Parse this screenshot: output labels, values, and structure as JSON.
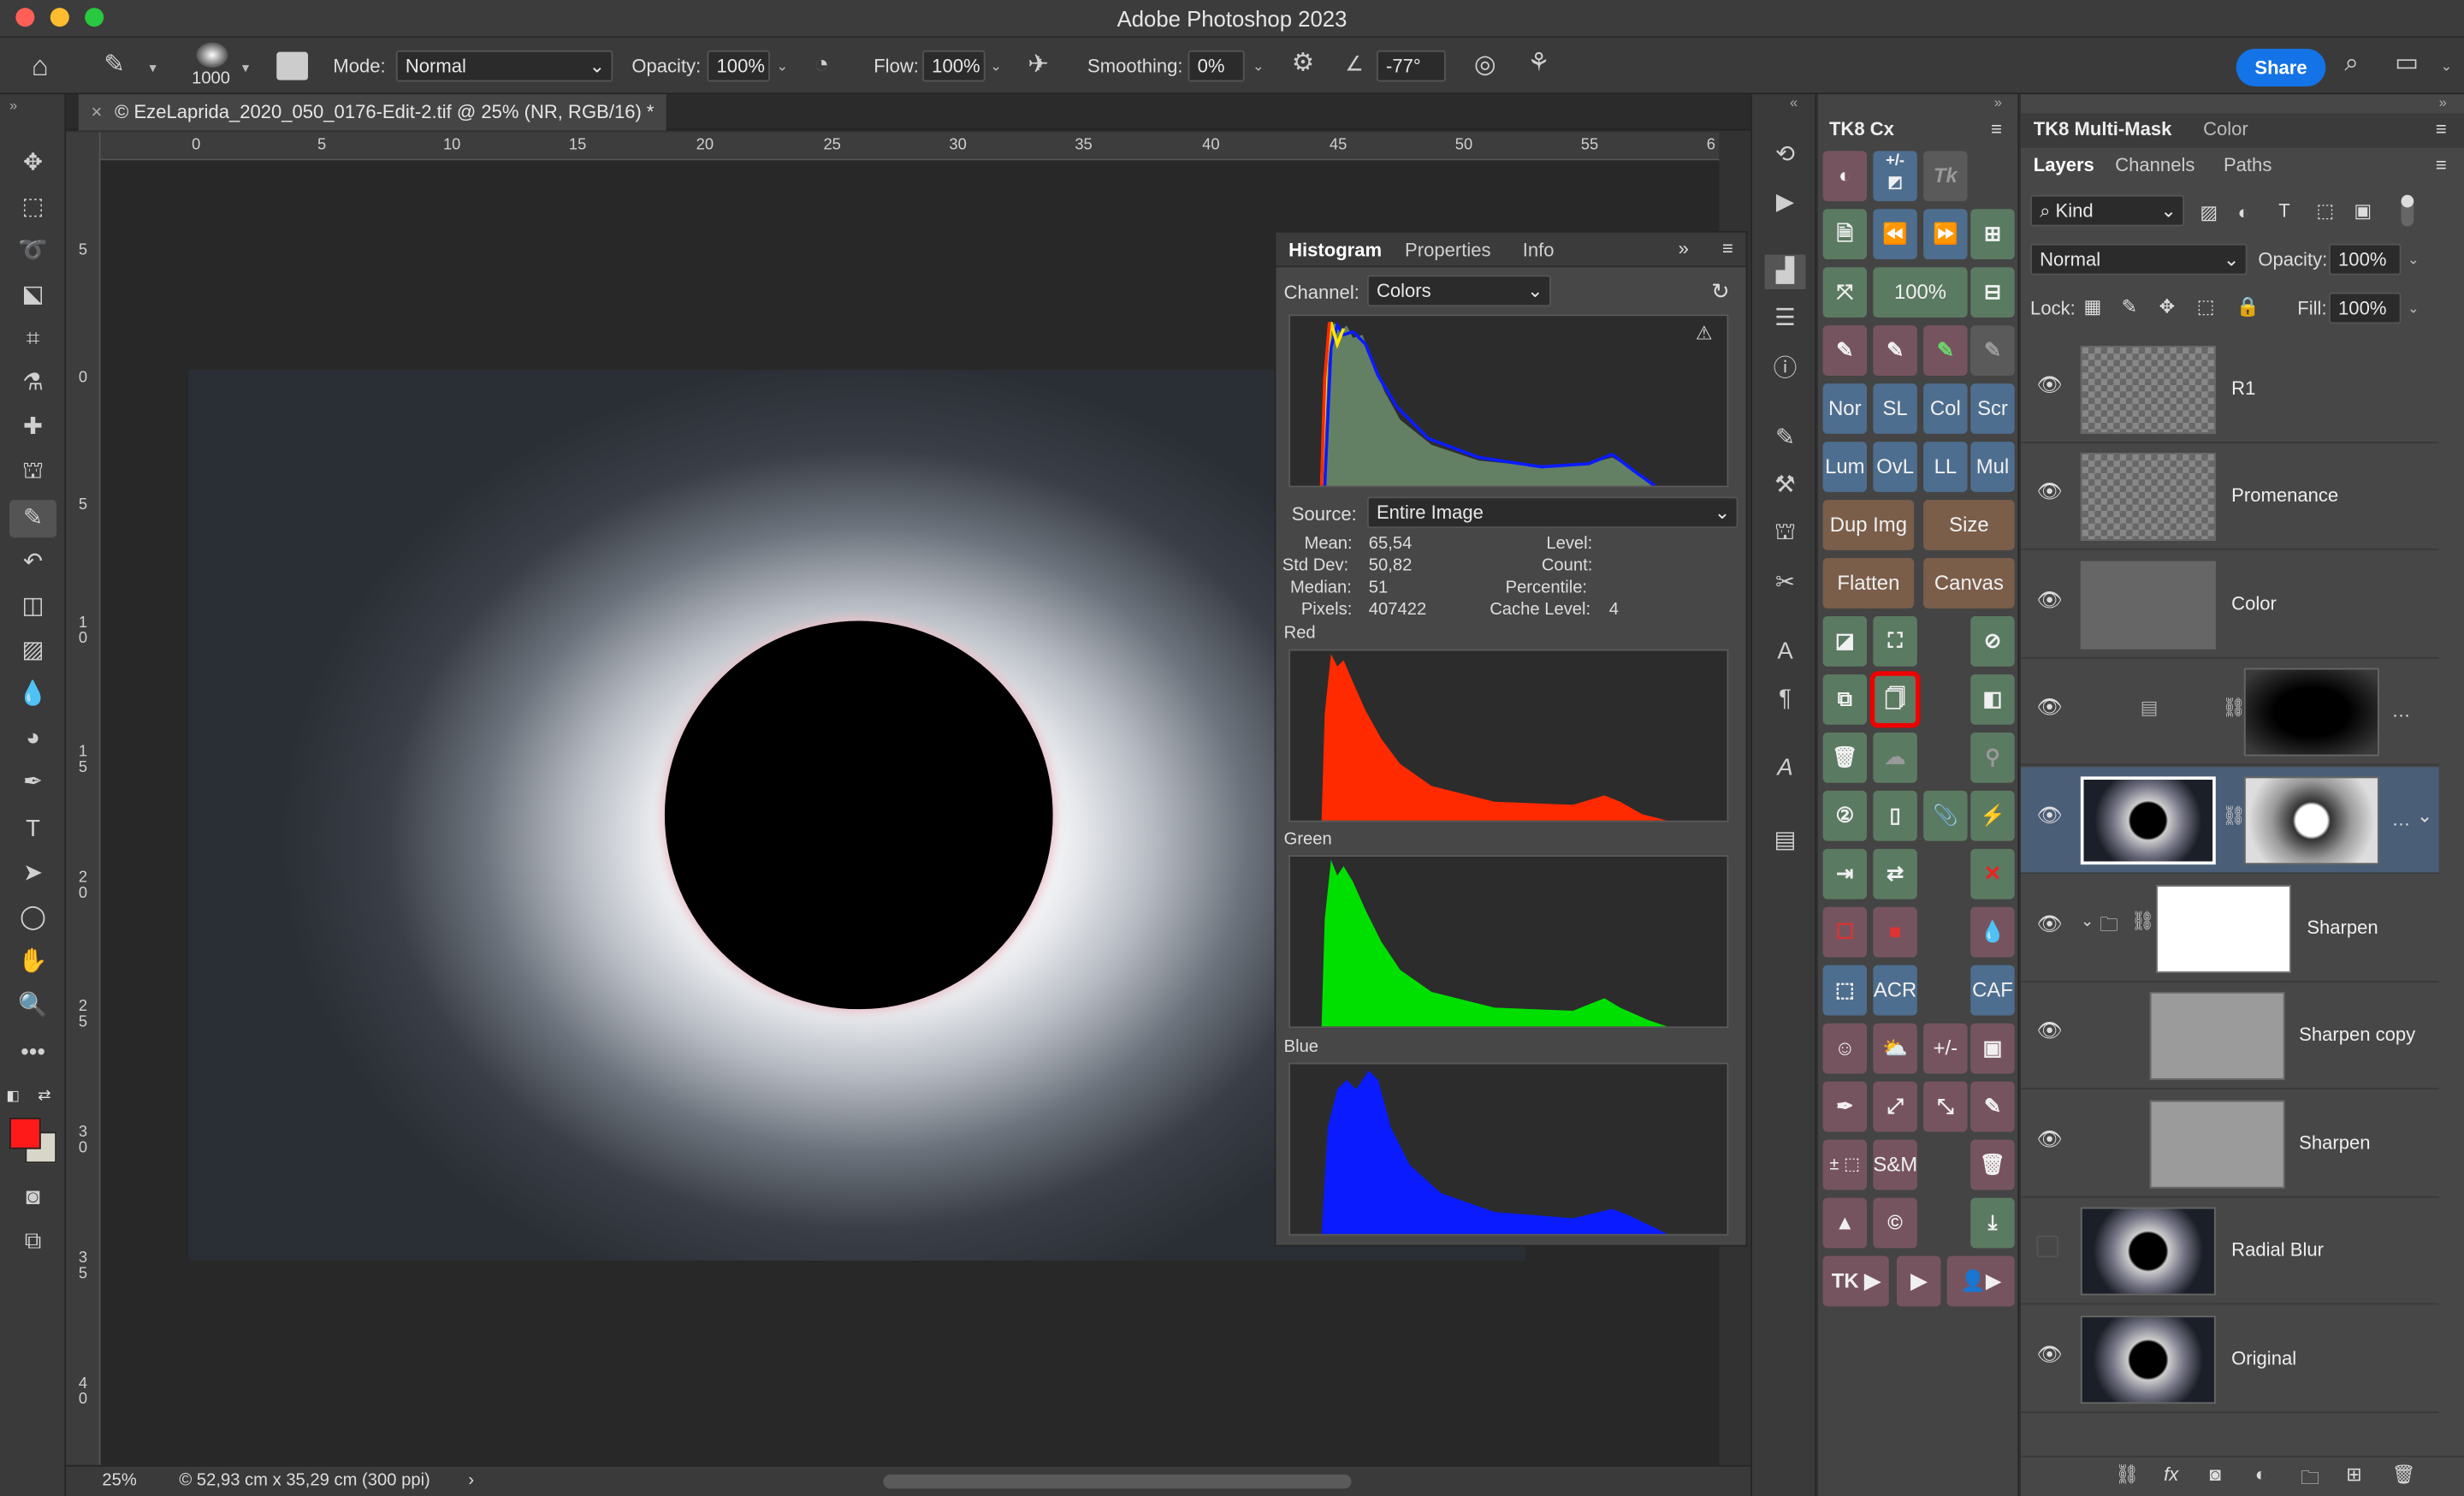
{
  "app": {
    "title": "Adobe Photoshop 2023"
  },
  "options": {
    "brush_size": "1000",
    "mode_label": "Mode:",
    "mode_value": "Normal",
    "opacity_label": "Opacity:",
    "opacity_value": "100%",
    "flow_label": "Flow:",
    "flow_value": "100%",
    "smoothing_label": "Smoothing:",
    "smoothing_value": "0%",
    "angle_value": "-77°",
    "share_label": "Share"
  },
  "document": {
    "tab_title": "© EzeLaprida_2020_050_0176-Edit-2.tif @ 25% (NR, RGB/16) *",
    "zoom": "25%",
    "doc_info": "© 52,93 cm x 35,29 cm (300 ppi)",
    "h_ruler": [
      "0",
      "5",
      "10",
      "15",
      "20",
      "25",
      "30",
      "35",
      "40",
      "45",
      "50",
      "55",
      "6"
    ],
    "v_ruler": [
      "5",
      "0",
      "5",
      "1 0",
      "1 5",
      "2 0",
      "2 5",
      "3 0",
      "3 5",
      "4 0"
    ]
  },
  "histogram": {
    "tabs": [
      "Histogram",
      "Properties",
      "Info"
    ],
    "channel_label": "Channel:",
    "channel_value": "Colors",
    "source_label": "Source:",
    "source_value": "Entire Image",
    "stats": {
      "mean_label": "Mean:",
      "mean": "65,54",
      "std_label": "Std Dev:",
      "std": "50,82",
      "median_label": "Median:",
      "median": "51",
      "pixels_label": "Pixels:",
      "pixels": "407422",
      "level_label": "Level:",
      "count_label": "Count:",
      "percentile_label": "Percentile:",
      "cache_label": "Cache Level:",
      "cache": "4"
    },
    "channels": [
      "Red",
      "Green",
      "Blue"
    ],
    "colors": {
      "red": "#ff2a00",
      "green": "#00e000",
      "blue": "#0a1cff"
    }
  },
  "tk8": {
    "title": "TK8 Cx",
    "zoom_btn": "100%",
    "row_blend": [
      "Nor",
      "SL",
      "Col",
      "Scr"
    ],
    "row_blend2": [
      "Lum",
      "OvL",
      "LL",
      "Mul"
    ],
    "dup_img": "Dup Img",
    "size": "Size",
    "flatten": "Flatten",
    "canvas": "Canvas",
    "plusminus": "+/-",
    "acr": "ACR",
    "caf": "CAF",
    "plusminus2": "+/-",
    "sm": "S&M",
    "pm_marquee": "±",
    "tk_play": "TK"
  },
  "layers_panel": {
    "header_tabs": [
      "TK8 Multi-Mask",
      "Color"
    ],
    "tabs": [
      "Layers",
      "Channels",
      "Paths"
    ],
    "kind": "Kind",
    "blend": "Normal",
    "opacity_label": "Opacity:",
    "opacity": "100%",
    "lock_label": "Lock:",
    "fill_label": "Fill:",
    "fill": "100%",
    "layers": [
      {
        "name": "R1",
        "visible": true
      },
      {
        "name": "Promenance",
        "visible": true
      },
      {
        "name": "Color",
        "visible": true
      },
      {
        "name": "",
        "visible": true
      },
      {
        "name": "",
        "visible": true
      },
      {
        "name": "Sharpen",
        "visible": true
      },
      {
        "name": "Sharpen copy",
        "visible": true
      },
      {
        "name": "Sharpen",
        "visible": true
      },
      {
        "name": "Radial Blur",
        "visible": false
      },
      {
        "name": "Original",
        "visible": true
      }
    ]
  }
}
